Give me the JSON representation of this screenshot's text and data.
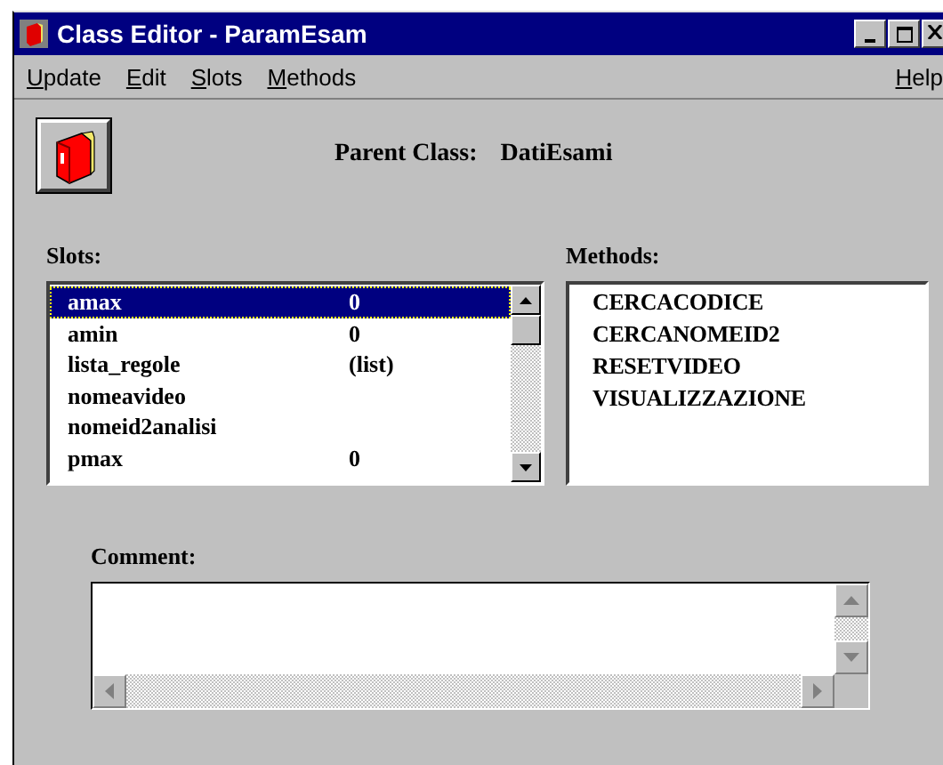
{
  "window": {
    "title": "Class Editor - ParamEsam"
  },
  "menu": [
    {
      "label": "Update"
    },
    {
      "label": "Edit"
    },
    {
      "label": "Slots"
    },
    {
      "label": "Methods"
    }
  ],
  "help_menu": {
    "label": "Help"
  },
  "parent_class": {
    "label": "Parent Class:",
    "value": "DatiEsami"
  },
  "slots": {
    "label": "Slots:",
    "items": [
      {
        "name": "amax",
        "value": "0",
        "selected": true
      },
      {
        "name": "amin",
        "value": "0",
        "selected": false
      },
      {
        "name": "lista_regole",
        "value": "(list)",
        "selected": false
      },
      {
        "name": "nomeavideo",
        "selected": false
      },
      {
        "name": "nomeid2analisi",
        "selected": false
      },
      {
        "name": "pmax",
        "value": "0",
        "selected": false
      }
    ]
  },
  "methods": {
    "label": "Methods:",
    "items": [
      {
        "name": "CERCACODICE",
        "selected": false
      },
      {
        "name": "CERCANOMEID2",
        "selected": false
      },
      {
        "name": "RESETVIDEO",
        "selected": false
      },
      {
        "name": "VISUALIZZAZIONE",
        "selected": false
      }
    ]
  },
  "comment": {
    "label": "Comment:"
  }
}
